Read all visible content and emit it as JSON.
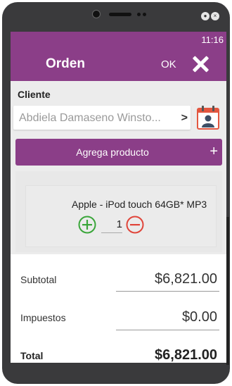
{
  "status_bar": {
    "time": "11:16"
  },
  "app_bar": {
    "title": "Orden",
    "ok_label": "OK",
    "close_icon": "close-icon"
  },
  "client": {
    "label": "Cliente",
    "value": "Abdiela Damaseno Winsto...",
    "chevron": ">"
  },
  "add_product": {
    "label": "Agrega producto",
    "plus": "+"
  },
  "product": {
    "name": "Apple - iPod touch 64GB* MP3",
    "quantity": "1"
  },
  "totals": {
    "subtotal_label": "Subtotal",
    "subtotal_value": "$6,821.00",
    "tax_label": "Impuestos",
    "tax_value": "$0.00",
    "total_label": "Total",
    "total_value": "$6,821.00"
  },
  "colors": {
    "brand": "#8b3e88",
    "add_green": "#3aa63a",
    "remove_red": "#e0453a",
    "calendar_red": "#e3563f"
  }
}
